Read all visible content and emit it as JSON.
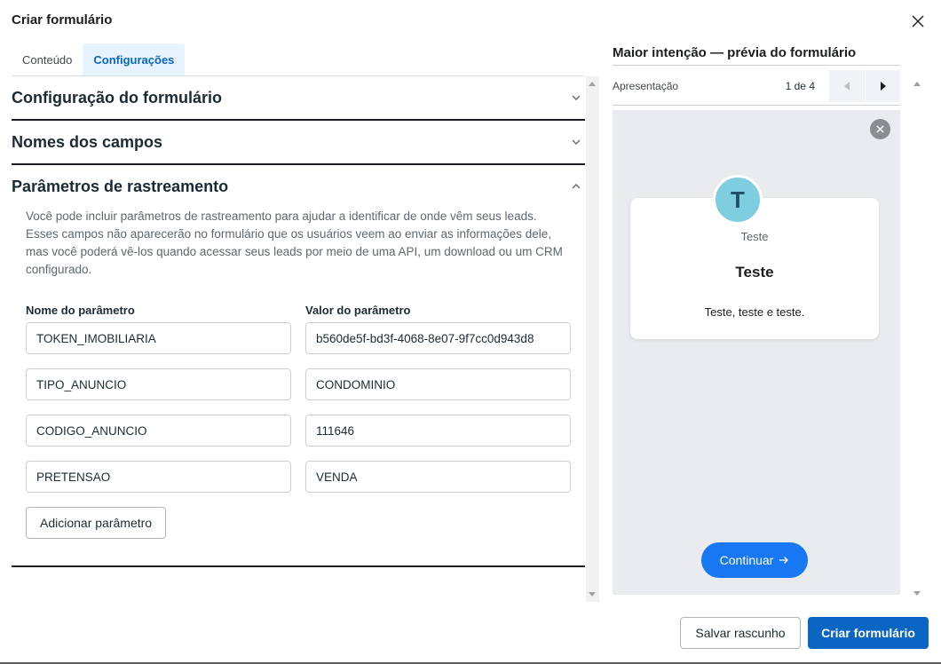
{
  "dialog": {
    "title": "Criar formulário",
    "close_icon": "close-icon"
  },
  "tabs": [
    {
      "label": "Conteúdo",
      "active": false
    },
    {
      "label": "Configurações",
      "active": true
    }
  ],
  "sections": [
    {
      "title": "Configuração do formulário",
      "expanded": false
    },
    {
      "title": "Nomes dos campos",
      "expanded": false
    },
    {
      "title": "Parâmetros de rastreamento",
      "expanded": true
    }
  ],
  "tracking": {
    "description": "Você pode incluir parâmetros de rastreamento para ajudar a identificar de onde vêm seus leads. Esses campos não aparecerão no formulário que os usuários veem ao enviar as informações dele, mas você poderá vê-los quando acessar seus leads por meio de uma API, um download ou um CRM configurado.",
    "name_header": "Nome do parâmetro",
    "value_header": "Valor do parâmetro",
    "params": [
      {
        "name": "TOKEN_IMOBILIARIA",
        "value": "b560de5f-bd3f-4068-8e07-9f7cc0d943d8"
      },
      {
        "name": "TIPO_ANUNCIO",
        "value": "CONDOMINIO"
      },
      {
        "name": "CODIGO_ANUNCIO",
        "value": "111646"
      },
      {
        "name": "PRETENSAO",
        "value": "VENDA"
      }
    ],
    "add_label": "Adicionar parâmetro"
  },
  "preview": {
    "title": "Maior intenção — prévia do formulário",
    "screen_label": "Apresentação",
    "page": "1 de 4",
    "avatar_letter": "T",
    "card_small": "Teste",
    "card_heading": "Teste",
    "card_text": "Teste, teste e teste.",
    "continue_label": "Continuar"
  },
  "footer": {
    "save_draft": "Salvar rascunho",
    "create": "Criar formulário"
  },
  "colors": {
    "primary": "#0a66c2",
    "active_tab_bg": "#e7f3ff",
    "continue_button": "#1877f2",
    "avatar": "#7fcee0"
  }
}
